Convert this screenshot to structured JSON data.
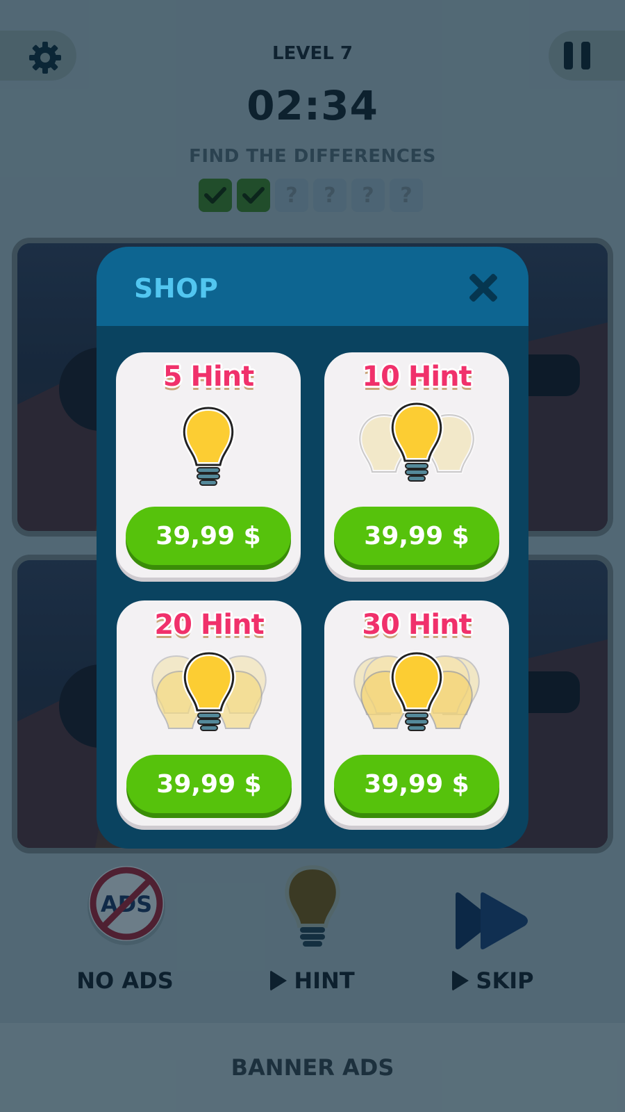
{
  "hud": {
    "level": "LEVEL 7",
    "timer": "02:34",
    "instruction": "FIND THE DIFFERENCES",
    "differences_found": 2,
    "differences_total": 6,
    "unknown_symbol": "?"
  },
  "bottom_bar": {
    "no_ads_label": "NO ADS",
    "no_ads_badge": "ADS",
    "hint_label": "HINT",
    "skip_label": "SKIP"
  },
  "banner": {
    "label": "BANNER ADS"
  },
  "shop": {
    "title": "SHOP",
    "items": [
      {
        "label": "5 Hint",
        "price": "39,99 $"
      },
      {
        "label": "10 Hint",
        "price": "39,99 $"
      },
      {
        "label": "20 Hint",
        "price": "39,99 $"
      },
      {
        "label": "30 Hint",
        "price": "39,99 $"
      }
    ]
  },
  "icons": {
    "settings": "gear-icon",
    "pause": "pause-icon",
    "close": "close-icon",
    "hint": "lightbulb-icon",
    "skip": "fast-forward-icon",
    "no_ads": "no-ads-icon",
    "play": "play-icon"
  },
  "colors": {
    "shop_bg": "#0a4360",
    "shop_header": "#0d6591",
    "shop_title": "#52c6f0",
    "hint_label": "#f0316b",
    "buy_button": "#56c20c",
    "bulb": "#fccd33",
    "check_box": "#2f6b2b"
  }
}
